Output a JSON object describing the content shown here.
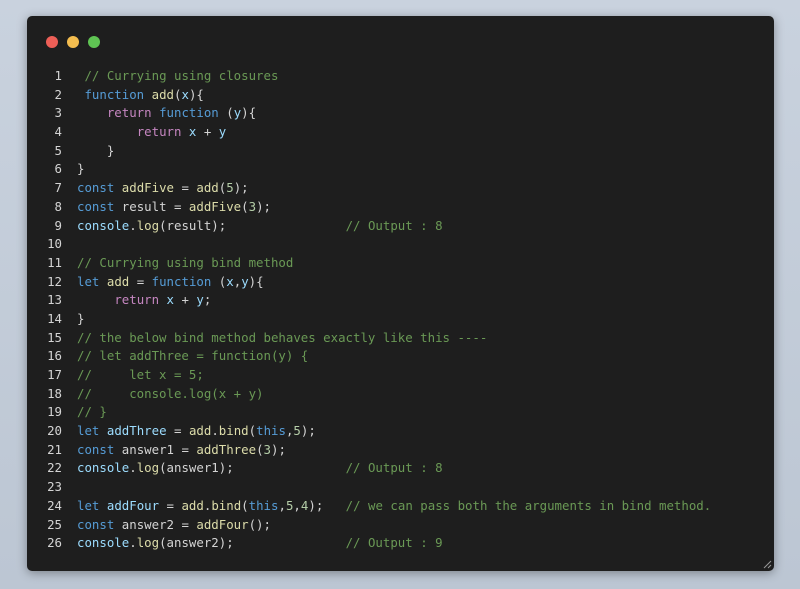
{
  "window": {
    "colors": {
      "background": "#1e1e1e",
      "traffic_red": "#ed5f57",
      "traffic_yellow": "#f4bd4f",
      "traffic_green": "#5fc453"
    }
  },
  "syntax_colors": {
    "plain": "#d4d4d4",
    "comment": "#6a9955",
    "keyword": "#569cd6",
    "control": "#c586c0",
    "function": "#dcdcaa",
    "variable": "#9cdcfe",
    "const": "#4fc1ff",
    "number": "#b5cea8"
  },
  "code": {
    "lines": [
      {
        "num": "1",
        "tokens": [
          {
            "t": " "
          },
          {
            "t": "// Currying using closures",
            "c": "comment"
          }
        ]
      },
      {
        "num": "2",
        "tokens": [
          {
            "t": " "
          },
          {
            "t": "function",
            "c": "keyword"
          },
          {
            "t": " "
          },
          {
            "t": "add",
            "c": "function"
          },
          {
            "t": "("
          },
          {
            "t": "x",
            "c": "variable"
          },
          {
            "t": "){"
          }
        ]
      },
      {
        "num": "3",
        "tokens": [
          {
            "t": "    "
          },
          {
            "t": "return",
            "c": "control"
          },
          {
            "t": " "
          },
          {
            "t": "function",
            "c": "keyword"
          },
          {
            "t": " ("
          },
          {
            "t": "y",
            "c": "variable"
          },
          {
            "t": "){"
          }
        ]
      },
      {
        "num": "4",
        "tokens": [
          {
            "t": "        "
          },
          {
            "t": "return",
            "c": "control"
          },
          {
            "t": " "
          },
          {
            "t": "x",
            "c": "variable"
          },
          {
            "t": " + "
          },
          {
            "t": "y",
            "c": "variable"
          }
        ]
      },
      {
        "num": "5",
        "tokens": [
          {
            "t": "    }"
          }
        ]
      },
      {
        "num": "6",
        "tokens": [
          {
            "t": "}"
          }
        ]
      },
      {
        "num": "7",
        "tokens": [
          {
            "t": "const",
            "c": "keyword"
          },
          {
            "t": " "
          },
          {
            "t": "addFive",
            "c": "function"
          },
          {
            "t": " = "
          },
          {
            "t": "add",
            "c": "function"
          },
          {
            "t": "("
          },
          {
            "t": "5",
            "c": "number"
          },
          {
            "t": ");"
          }
        ]
      },
      {
        "num": "8",
        "tokens": [
          {
            "t": "const",
            "c": "keyword"
          },
          {
            "t": " result = "
          },
          {
            "t": "addFive",
            "c": "function"
          },
          {
            "t": "("
          },
          {
            "t": "3",
            "c": "number"
          },
          {
            "t": ");"
          }
        ]
      },
      {
        "num": "9",
        "tokens": [
          {
            "t": "console",
            "c": "variable"
          },
          {
            "t": "."
          },
          {
            "t": "log",
            "c": "function"
          },
          {
            "t": "(result);"
          },
          {
            "t": "                "
          },
          {
            "t": "// Output : 8",
            "c": "comment"
          }
        ]
      },
      {
        "num": "10",
        "tokens": [
          {
            "t": ""
          }
        ]
      },
      {
        "num": "11",
        "tokens": [
          {
            "t": "// Currying using bind method",
            "c": "comment"
          }
        ]
      },
      {
        "num": "12",
        "tokens": [
          {
            "t": "let",
            "c": "keyword"
          },
          {
            "t": " "
          },
          {
            "t": "add",
            "c": "function"
          },
          {
            "t": " = "
          },
          {
            "t": "function",
            "c": "keyword"
          },
          {
            "t": " ("
          },
          {
            "t": "x",
            "c": "variable"
          },
          {
            "t": ","
          },
          {
            "t": "y",
            "c": "variable"
          },
          {
            "t": "){"
          }
        ]
      },
      {
        "num": "13",
        "tokens": [
          {
            "t": "     "
          },
          {
            "t": "return",
            "c": "control"
          },
          {
            "t": " "
          },
          {
            "t": "x",
            "c": "variable"
          },
          {
            "t": " + "
          },
          {
            "t": "y",
            "c": "variable"
          },
          {
            "t": ";"
          }
        ]
      },
      {
        "num": "14",
        "tokens": [
          {
            "t": "}"
          }
        ]
      },
      {
        "num": "15",
        "tokens": [
          {
            "t": "// the below bind method behaves exactly like this ----",
            "c": "comment"
          }
        ]
      },
      {
        "num": "16",
        "tokens": [
          {
            "t": "// let addThree = function(y) {",
            "c": "comment"
          }
        ]
      },
      {
        "num": "17",
        "tokens": [
          {
            "t": "//     let x = 5;",
            "c": "comment"
          }
        ]
      },
      {
        "num": "18",
        "tokens": [
          {
            "t": "//     console.log(x + y)",
            "c": "comment"
          }
        ]
      },
      {
        "num": "19",
        "tokens": [
          {
            "t": "// }",
            "c": "comment"
          }
        ]
      },
      {
        "num": "20",
        "tokens": [
          {
            "t": "let",
            "c": "keyword"
          },
          {
            "t": " "
          },
          {
            "t": "addThree",
            "c": "variable"
          },
          {
            "t": " = "
          },
          {
            "t": "add",
            "c": "function"
          },
          {
            "t": "."
          },
          {
            "t": "bind",
            "c": "function"
          },
          {
            "t": "("
          },
          {
            "t": "this",
            "c": "keyword"
          },
          {
            "t": ","
          },
          {
            "t": "5",
            "c": "number"
          },
          {
            "t": ");"
          }
        ]
      },
      {
        "num": "21",
        "tokens": [
          {
            "t": "const",
            "c": "keyword"
          },
          {
            "t": " answer1 = "
          },
          {
            "t": "addThree",
            "c": "function"
          },
          {
            "t": "("
          },
          {
            "t": "3",
            "c": "number"
          },
          {
            "t": ");"
          }
        ]
      },
      {
        "num": "22",
        "tokens": [
          {
            "t": "console",
            "c": "variable"
          },
          {
            "t": "."
          },
          {
            "t": "log",
            "c": "function"
          },
          {
            "t": "(answer1);"
          },
          {
            "t": "               "
          },
          {
            "t": "// Output : 8",
            "c": "comment"
          }
        ]
      },
      {
        "num": "23",
        "tokens": [
          {
            "t": ""
          }
        ]
      },
      {
        "num": "24",
        "tokens": [
          {
            "t": "let",
            "c": "keyword"
          },
          {
            "t": " "
          },
          {
            "t": "addFour",
            "c": "variable"
          },
          {
            "t": " = "
          },
          {
            "t": "add",
            "c": "function"
          },
          {
            "t": "."
          },
          {
            "t": "bind",
            "c": "function"
          },
          {
            "t": "("
          },
          {
            "t": "this",
            "c": "keyword"
          },
          {
            "t": ","
          },
          {
            "t": "5",
            "c": "number"
          },
          {
            "t": ","
          },
          {
            "t": "4",
            "c": "number"
          },
          {
            "t": ");"
          },
          {
            "t": "   "
          },
          {
            "t": "// we can pass both the arguments in bind method.",
            "c": "comment"
          }
        ]
      },
      {
        "num": "25",
        "tokens": [
          {
            "t": "const",
            "c": "keyword"
          },
          {
            "t": " answer2 = "
          },
          {
            "t": "addFour",
            "c": "function"
          },
          {
            "t": "();"
          }
        ]
      },
      {
        "num": "26",
        "tokens": [
          {
            "t": "console",
            "c": "variable"
          },
          {
            "t": "."
          },
          {
            "t": "log",
            "c": "function"
          },
          {
            "t": "(answer2);"
          },
          {
            "t": "               "
          },
          {
            "t": "// Output : 9",
            "c": "comment"
          }
        ]
      }
    ]
  }
}
